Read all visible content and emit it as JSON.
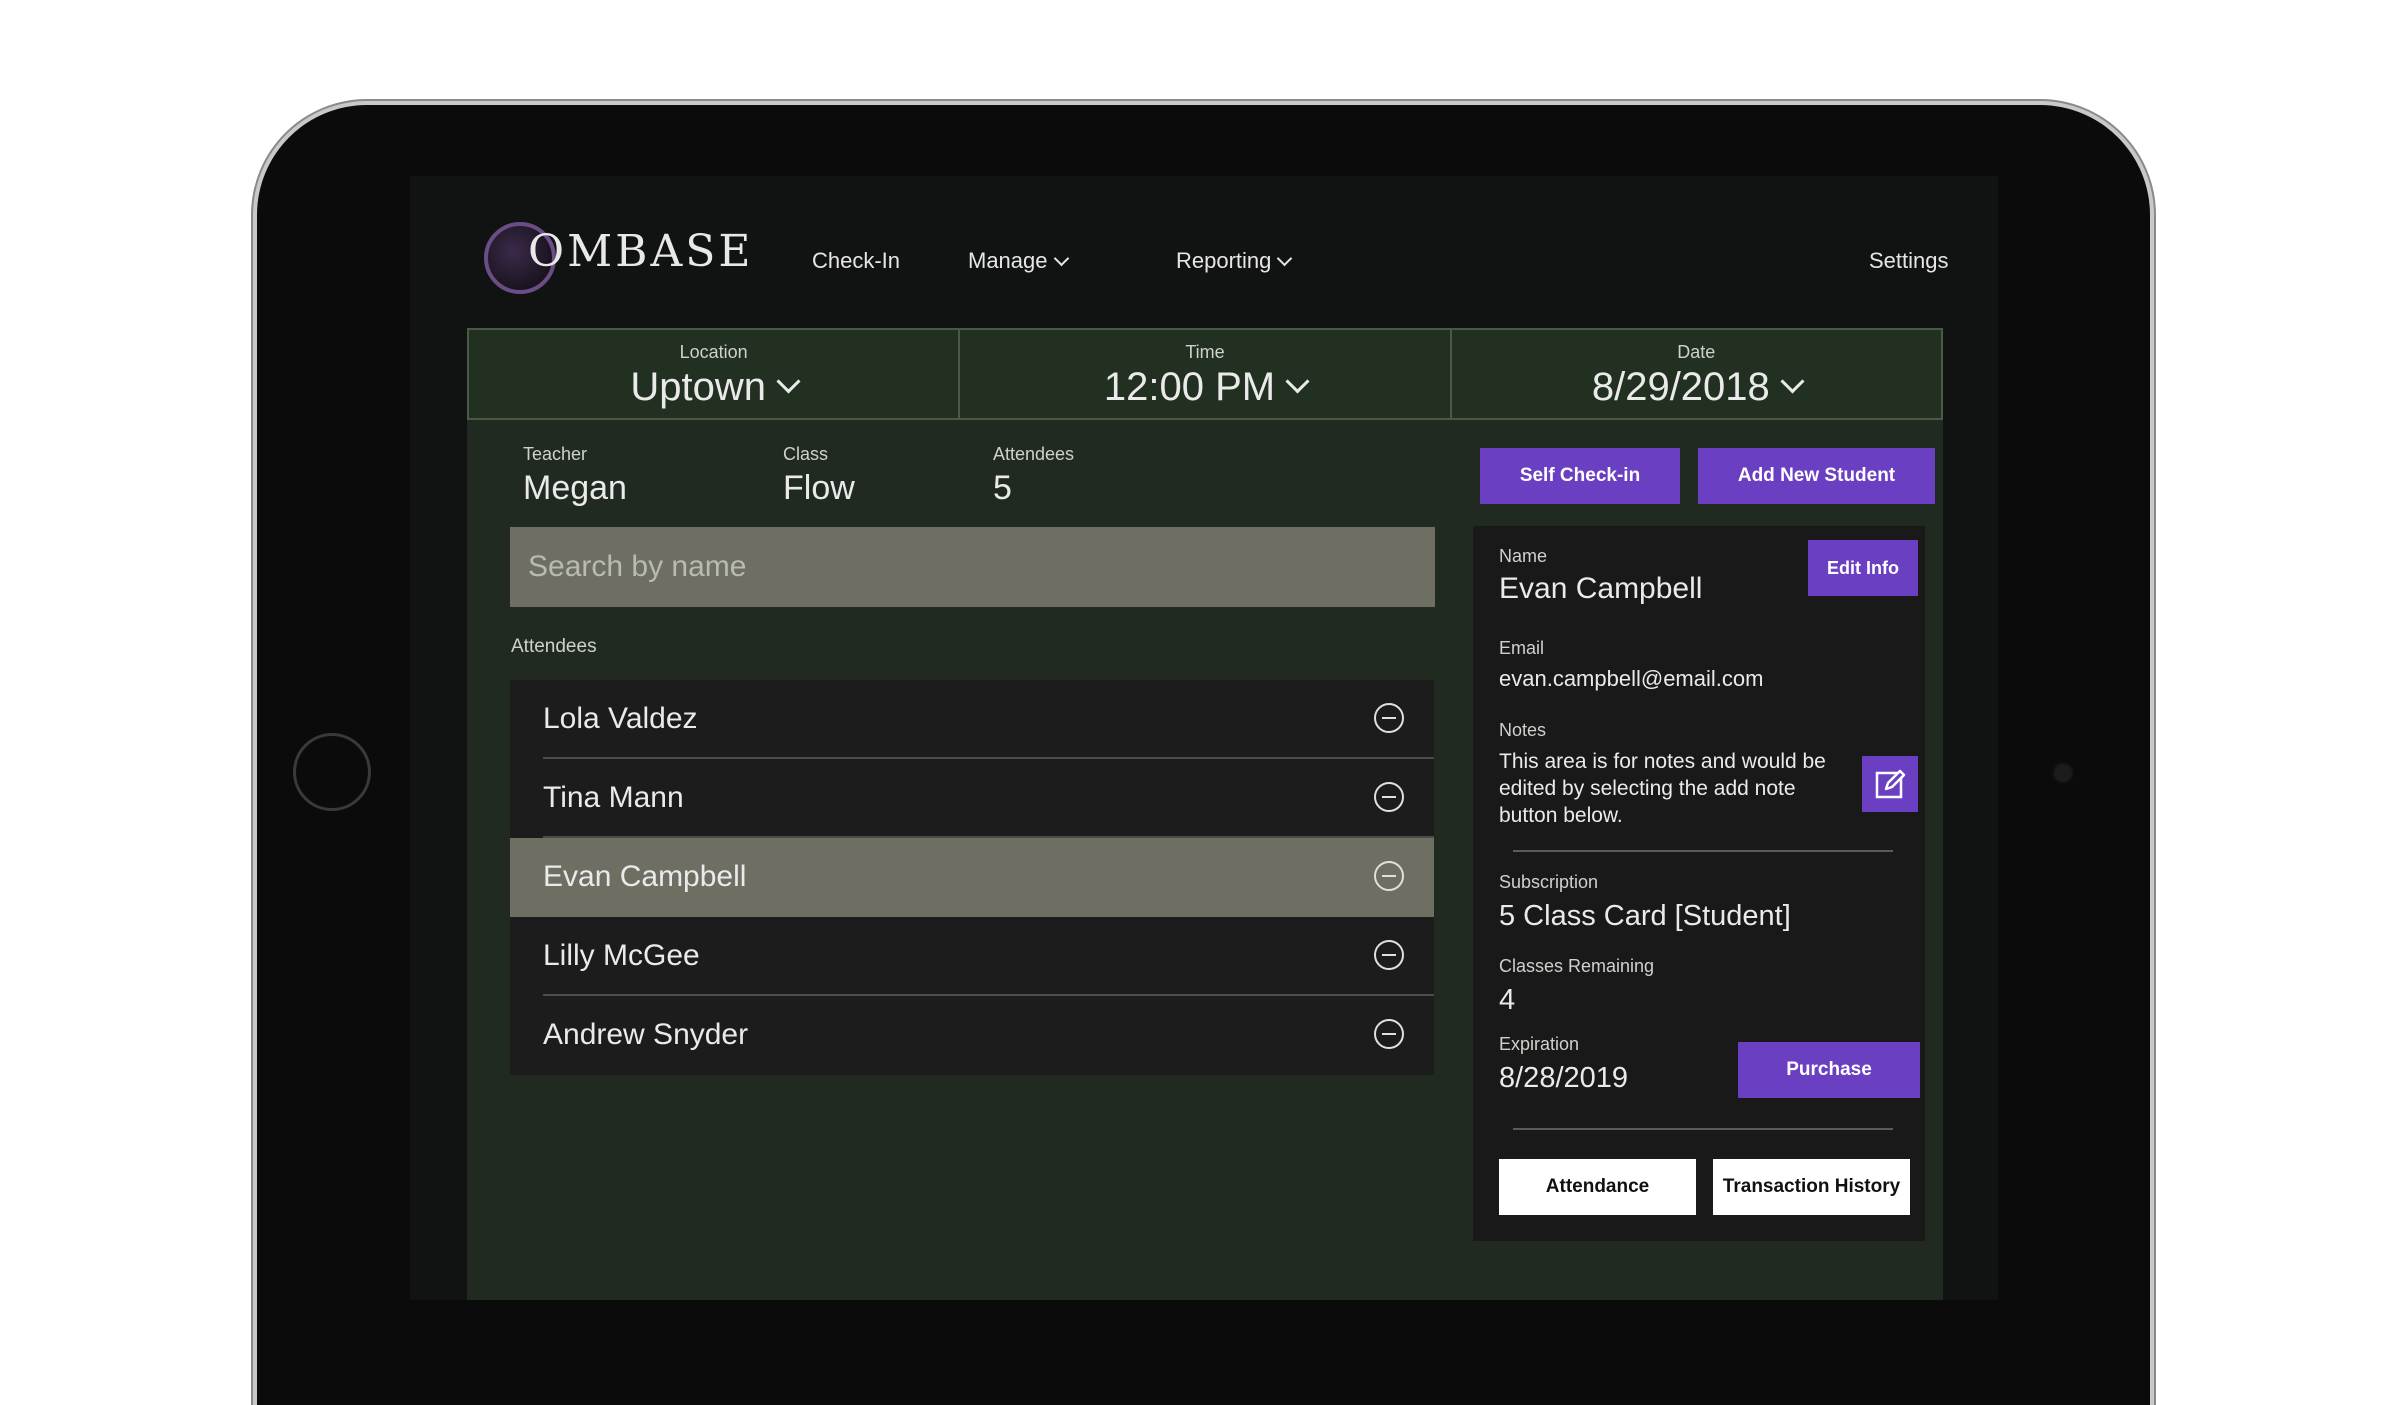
{
  "nav": {
    "logo_text": "OMBASE",
    "checkin": "Check-In",
    "manage": "Manage",
    "reporting": "Reporting",
    "settings": "Settings"
  },
  "selectors": {
    "location": {
      "label": "Location",
      "value": "Uptown"
    },
    "time": {
      "label": "Time",
      "value": "12:00 PM"
    },
    "date": {
      "label": "Date",
      "value": "8/29/2018"
    }
  },
  "class_info": {
    "teacher_label": "Teacher",
    "teacher": "Megan",
    "class_label": "Class",
    "class": "Flow",
    "attendees_label": "Attendees",
    "attendees_count": "5"
  },
  "search": {
    "placeholder": "Search by name"
  },
  "attendees": {
    "label": "Attendees",
    "items": [
      "Lola Valdez",
      "Tina Mann",
      "Evan Campbell",
      "Lilly McGee",
      "Andrew Snyder"
    ],
    "selected": "Evan Campbell"
  },
  "actions": {
    "self_checkin": "Self Check-in",
    "add_student": "Add New Student"
  },
  "student": {
    "name_label": "Name",
    "name": "Evan Campbell",
    "edit_info": "Edit Info",
    "email_label": "Email",
    "email": "evan.campbell@email.com",
    "notes_label": "Notes",
    "notes": "This area is for notes and would be edited by selecting the add note button below.",
    "subscription_label": "Subscription",
    "subscription": "5 Class Card [Student]",
    "remaining_label": "Classes Remaining",
    "remaining": "4",
    "expiration_label": "Expiration",
    "expiration": "8/28/2019",
    "purchase": "Purchase",
    "attendance": "Attendance",
    "transactions": "Transaction History"
  },
  "colors": {
    "accent": "#6a3fc2",
    "panel": "#212a20",
    "selected_row": "#6e6f62"
  }
}
